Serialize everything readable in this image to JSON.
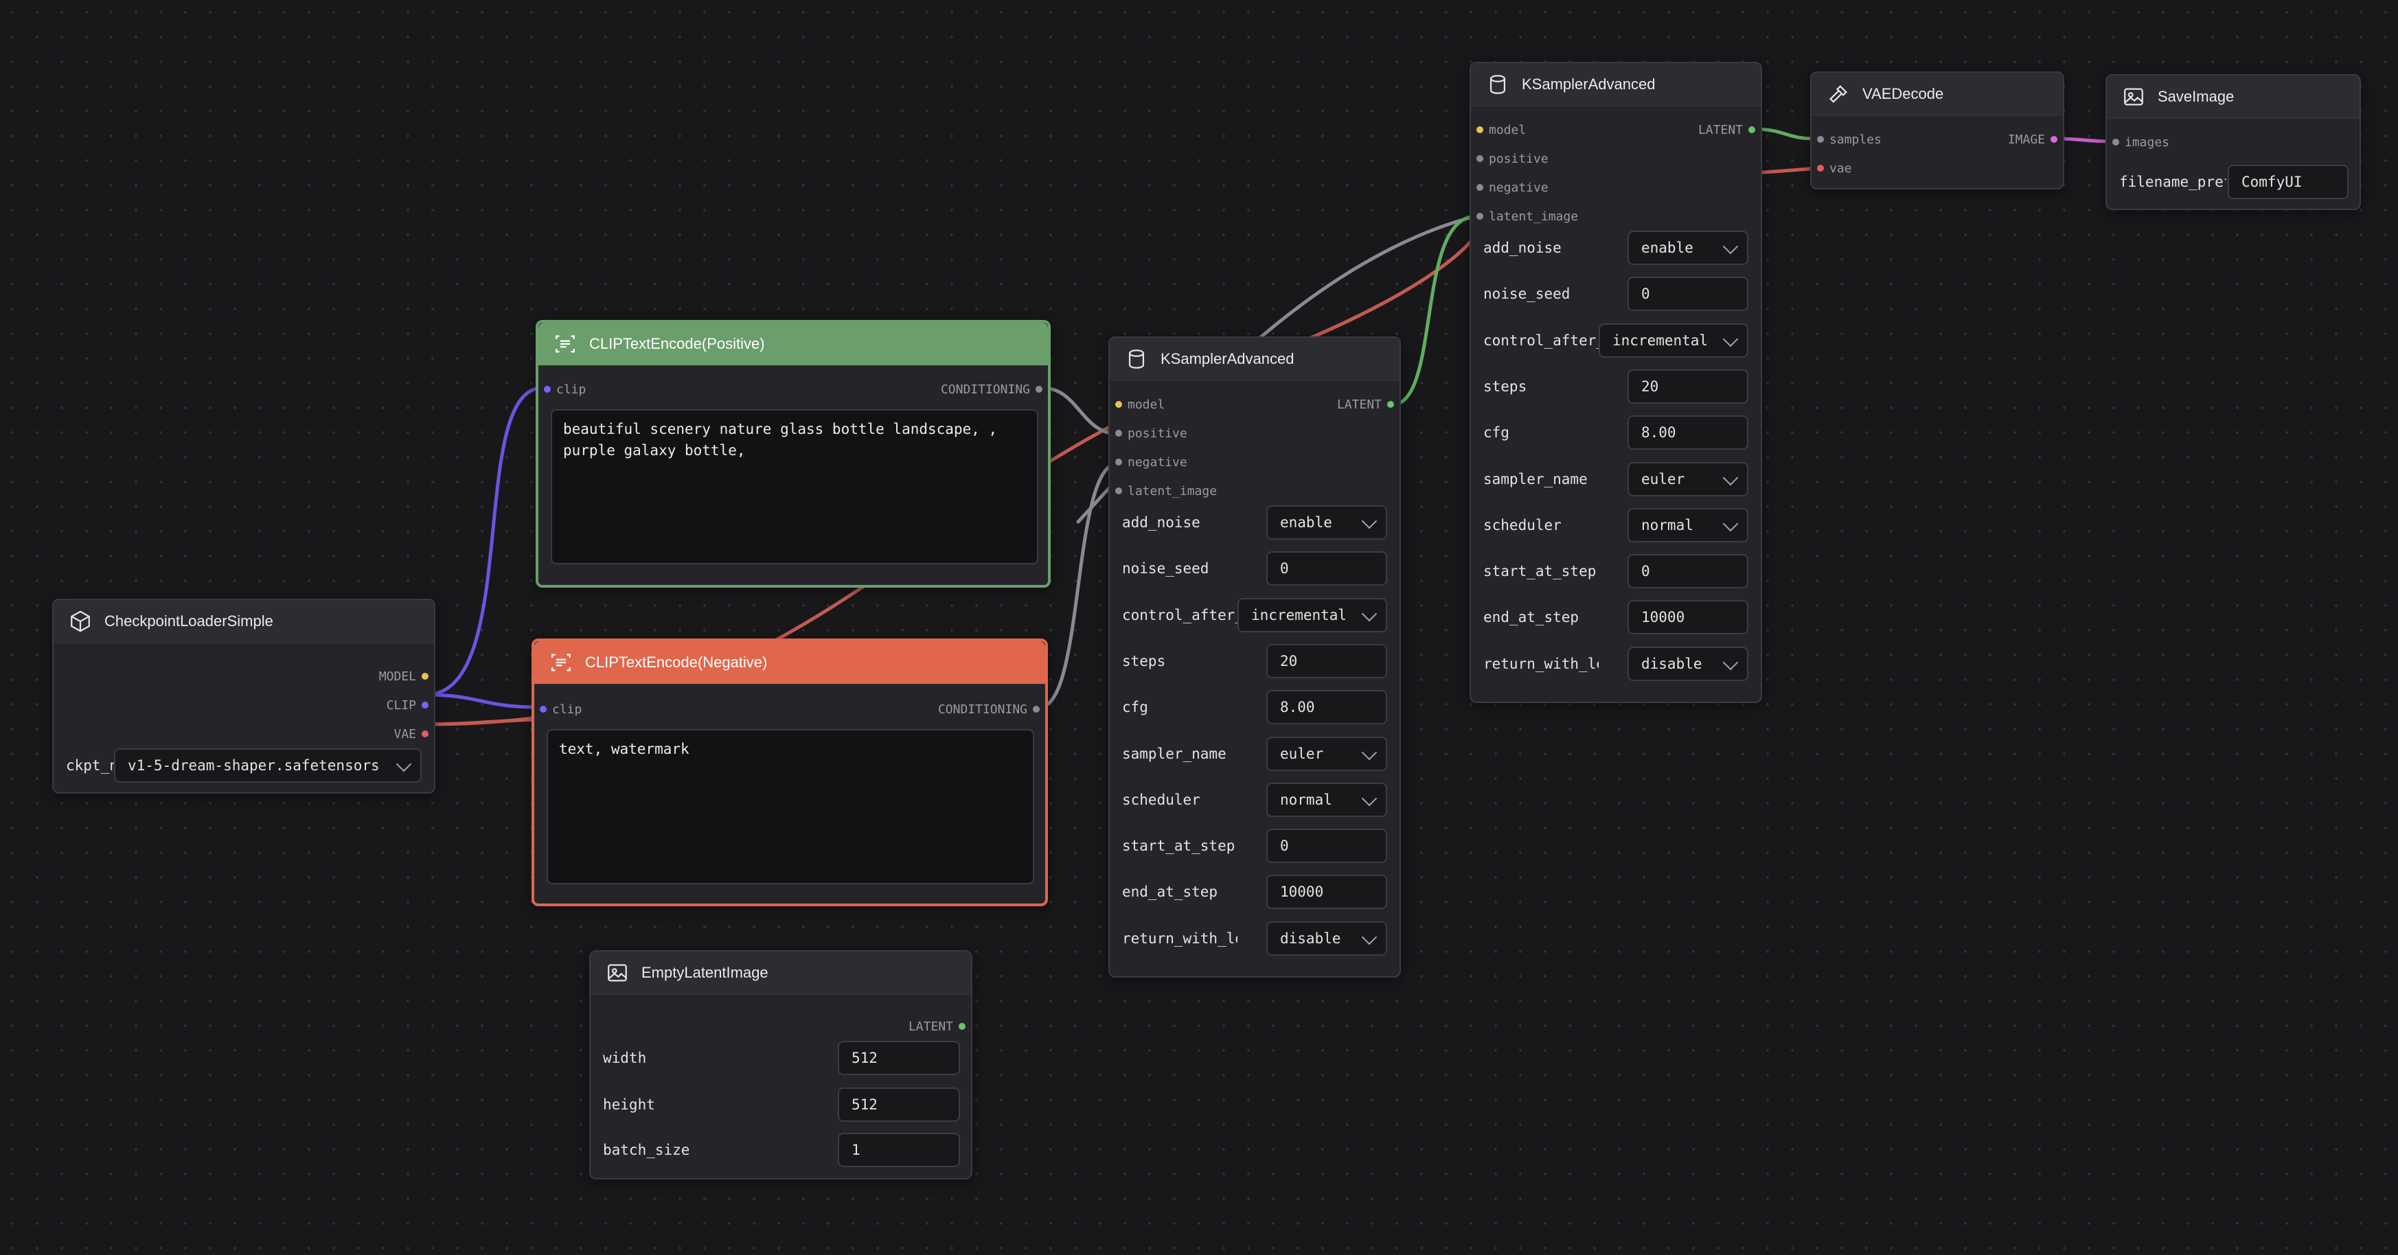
{
  "colors": {
    "model": "#e8c252",
    "clip": "#7a62ff",
    "vae": "#e05e5e",
    "conditioning": "#9a9aa2",
    "latent": "#6ac46a",
    "image": "#d866d8",
    "positive_header": "#6a9e6a",
    "negative_header": "#e0664c"
  },
  "checkpoint": {
    "title": "CheckpointLoaderSimple",
    "icon": "cube-icon",
    "outputs": [
      "MODEL",
      "CLIP",
      "VAE"
    ],
    "ckpt_label": "ckpt_name",
    "ckpt_value": "v1-5-dream-shaper.safetensors"
  },
  "clip_positive": {
    "title": "CLIPTextEncode(Positive)",
    "icon": "text-scan-icon",
    "input": "clip",
    "output": "CONDITIONING",
    "text": "beautiful scenery nature glass bottle landscape, , purple galaxy bottle,"
  },
  "clip_negative": {
    "title": "CLIPTextEncode(Negative)",
    "icon": "text-scan-icon",
    "input": "clip",
    "output": "CONDITIONING",
    "text": "text, watermark"
  },
  "latent": {
    "title": "EmptyLatentImage",
    "icon": "image-icon",
    "output": "LATENT",
    "width_label": "width",
    "width": "512",
    "height_label": "height",
    "height": "512",
    "batch_label": "batch_size",
    "batch": "1"
  },
  "ksampler1": {
    "title": "KSamplerAdvanced",
    "icon": "cylinder-icon",
    "inputs": [
      "model",
      "positive",
      "negative",
      "latent_image"
    ],
    "output": "LATENT",
    "widgets": [
      {
        "label": "add_noise",
        "value": "enable",
        "dropdown": true
      },
      {
        "label": "noise_seed",
        "value": "0",
        "dropdown": false
      },
      {
        "label": "control_after_generate",
        "value": "incremental",
        "dropdown": true
      },
      {
        "label": "steps",
        "value": "20",
        "dropdown": false
      },
      {
        "label": "cfg",
        "value": "8.00",
        "dropdown": false
      },
      {
        "label": "sampler_name",
        "value": "euler",
        "dropdown": true
      },
      {
        "label": "scheduler",
        "value": "normal",
        "dropdown": true
      },
      {
        "label": "start_at_step",
        "value": "0",
        "dropdown": false
      },
      {
        "label": "end_at_step",
        "value": "10000",
        "dropdown": false
      },
      {
        "label": "return_with_leftover_noise",
        "value": "disable",
        "dropdown": true
      }
    ]
  },
  "ksampler2": {
    "title": "KSamplerAdvanced",
    "icon": "cylinder-icon",
    "inputs": [
      "model",
      "positive",
      "negative",
      "latent_image"
    ],
    "output": "LATENT",
    "widgets": [
      {
        "label": "add_noise",
        "value": "enable",
        "dropdown": true
      },
      {
        "label": "noise_seed",
        "value": "0",
        "dropdown": false
      },
      {
        "label": "control_after_generate",
        "value": "incremental",
        "dropdown": true
      },
      {
        "label": "steps",
        "value": "20",
        "dropdown": false
      },
      {
        "label": "cfg",
        "value": "8.00",
        "dropdown": false
      },
      {
        "label": "sampler_name",
        "value": "euler",
        "dropdown": true
      },
      {
        "label": "scheduler",
        "value": "normal",
        "dropdown": true
      },
      {
        "label": "start_at_step",
        "value": "0",
        "dropdown": false
      },
      {
        "label": "end_at_step",
        "value": "10000",
        "dropdown": false
      },
      {
        "label": "return_with_leftover_noise",
        "value": "disable",
        "dropdown": true
      }
    ]
  },
  "vaedecode": {
    "title": "VAEDecode",
    "icon": "hammer-icon",
    "inputs": [
      "samples",
      "vae"
    ],
    "output": "IMAGE"
  },
  "saveimage": {
    "title": "SaveImage",
    "icon": "image-icon",
    "input": "images",
    "filename_label": "filename_prefix",
    "filename_value": "ComfyUI"
  }
}
